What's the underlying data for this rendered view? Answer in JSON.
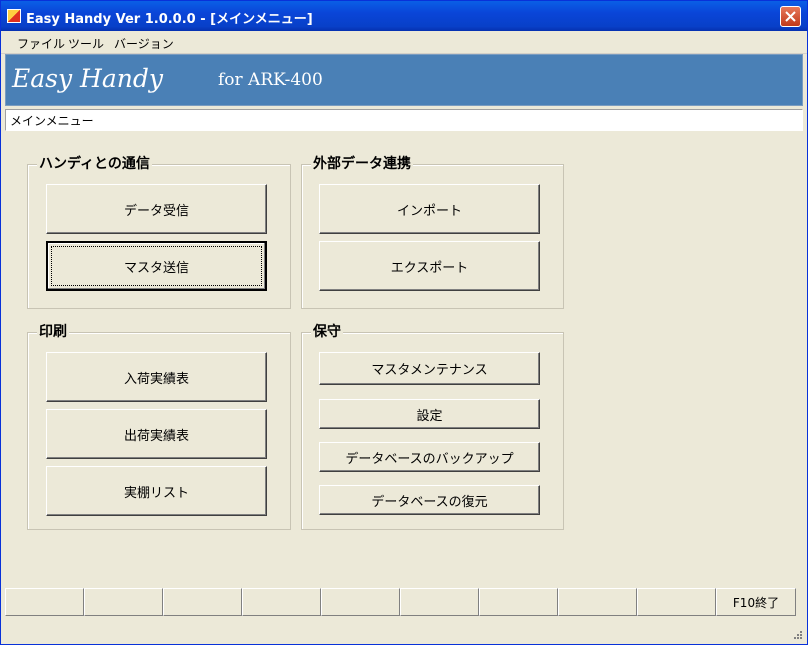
{
  "window": {
    "title": "Easy Handy  Ver 1.0.0.0 - [メインメニュー]"
  },
  "menu": {
    "items": [
      "ファイル",
      "ツール",
      "バージョン"
    ]
  },
  "banner": {
    "brand": "Easy Handy",
    "model": "for ARK-400"
  },
  "screen": {
    "title": "メインメニュー"
  },
  "groups": {
    "handy": {
      "label": "ハンディとの通信",
      "buttons": [
        "データ受信",
        "マスタ送信"
      ]
    },
    "external": {
      "label": "外部データ連携",
      "buttons": [
        "インポート",
        "エクスポート"
      ]
    },
    "print": {
      "label": "印刷",
      "buttons": [
        "入荷実績表",
        "出荷実績表",
        "実棚リスト"
      ]
    },
    "maintenance": {
      "label": "保守",
      "buttons": [
        "マスタメンテナンス",
        "設定",
        "データベースのバックアップ",
        "データベースの復元"
      ]
    }
  },
  "statusbar": {
    "keys": [
      "",
      "",
      "",
      "",
      "",
      "",
      "",
      "",
      "",
      "F10終了"
    ]
  },
  "icons": {
    "app": "app-icon",
    "close": "close-icon",
    "grip": "resize-grip-icon"
  },
  "colors": {
    "titlebar": "#0a45d8",
    "banner": "#4a80b6",
    "close": "#c0391a",
    "face": "#ece9d8"
  }
}
